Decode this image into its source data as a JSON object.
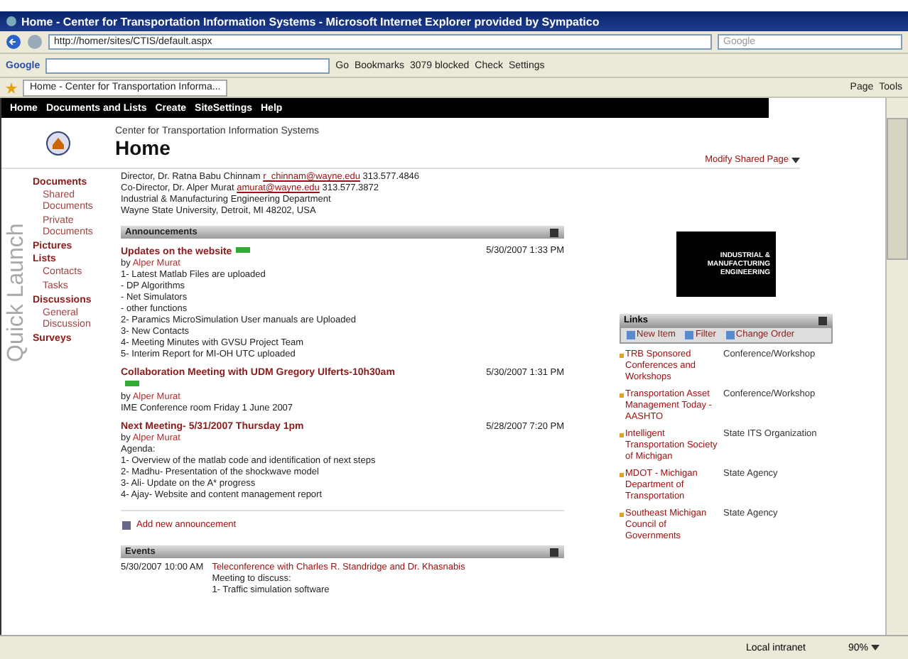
{
  "window": {
    "title": "Home - Center for Transportation Information Systems - Microsoft Internet Explorer provided by Sympatico"
  },
  "address_bar": {
    "url": "http://homer/sites/CTIS/default.aspx",
    "search_placeholder": "Google"
  },
  "google_toolbar": {
    "logo": "Google",
    "items": [
      "Go",
      "Bookmarks",
      "3079 blocked",
      "Check",
      "Settings"
    ]
  },
  "tab_bar": {
    "tab": "Home - Center for Transportation Informa...",
    "commands": [
      "Page",
      "Tools"
    ]
  },
  "nav": [
    "Home",
    "Documents and Lists",
    "Create",
    "SiteSettings",
    "Help"
  ],
  "site": {
    "subtitle": "Center for Transportation Information Systems",
    "title": "Home",
    "modify": "Modify Shared Page"
  },
  "sidebar": {
    "label": "Quick Launch",
    "sections": [
      {
        "title": "Documents",
        "children": [
          "Shared Documents",
          "Private Documents"
        ]
      },
      {
        "title": "Pictures"
      },
      {
        "title": "Lists",
        "children": [
          "Contacts",
          "Tasks"
        ]
      },
      {
        "title": "Discussions",
        "children": [
          "General Discussion"
        ]
      },
      {
        "title": "Surveys"
      }
    ]
  },
  "contacts": [
    {
      "before": "Director, Dr. Ratna Babu Chinnam ",
      "link": "r_chinnam@wayne.edu",
      "after": " 313.577.4846"
    },
    {
      "before": "Co-Director, Dr. Alper Murat ",
      "link": "amurat@wayne.edu",
      "after": " 313.577.3872"
    },
    {
      "before": "Industrial & Manufacturing Engineering Department"
    },
    {
      "before": "Wayne State University, Detroit, MI 48202, USA"
    }
  ],
  "announcements": {
    "title": "Announcements",
    "add": "Add new announcement",
    "items": [
      {
        "title": "Updates on the website",
        "new": true,
        "by": "by",
        "author": "Alper Murat",
        "date": "5/30/2007 1:33 PM",
        "body": [
          "1- Latest Matlab Files are uploaded",
          "- DP Algorithms",
          "- Net Simulators",
          "- other functions",
          "2- Paramics MicroSimulation User manuals are Uploaded",
          "3- New Contacts",
          "4- Meeting Minutes with GVSU Project Team",
          "5- Interim Report for MI-OH UTC uploaded"
        ]
      },
      {
        "title": "Collaboration Meeting with UDM Gregory Ulferts-10h30am",
        "new": true,
        "by": "by",
        "author": "Alper Murat",
        "date": "5/30/2007 1:31 PM",
        "body": [
          "IME Conference room Friday 1 June 2007"
        ]
      },
      {
        "title": "Next Meeting- 5/31/2007 Thursday 1pm",
        "new": false,
        "by": "by",
        "author": "Alper Murat",
        "date": "5/28/2007 7:20 PM",
        "body": [
          "Agenda:",
          "1- Overview of the matlab code and identification of next steps",
          "2- Madhu- Presentation of the shockwave model",
          "3- Ali- Update on the A* progress",
          "4- Ajay- Website and content management report"
        ]
      }
    ]
  },
  "events": {
    "title": "Events",
    "items": [
      {
        "date": "5/30/2007 10:00 AM",
        "title": "Teleconference with Charles R. Standridge and Dr. Khasnabis",
        "body": [
          "Meeting to discuss:",
          "1- Traffic simulation software"
        ]
      }
    ]
  },
  "logo": [
    "INDUSTRIAL &",
    "MANUFACTURING",
    "ENGINEERING"
  ],
  "links": {
    "title": "Links",
    "actions": [
      "New Item",
      "Filter",
      "Change Order"
    ],
    "items": [
      {
        "title": "TRB Sponsored Conferences and Workshops",
        "type": "Conference/Workshop"
      },
      {
        "title": "Transportation Asset Management Today - AASHTO",
        "type": "Conference/Workshop"
      },
      {
        "title": "Intelligent Transportation Society of Michigan",
        "type": "State ITS Organization"
      },
      {
        "title": "MDOT - Michigan Department of Transportation",
        "type": "State Agency"
      },
      {
        "title": "Southeast Michigan Council of Governments",
        "type": "State Agency"
      }
    ]
  },
  "status_bar": {
    "zone": "Local intranet",
    "zoom": "90%"
  }
}
